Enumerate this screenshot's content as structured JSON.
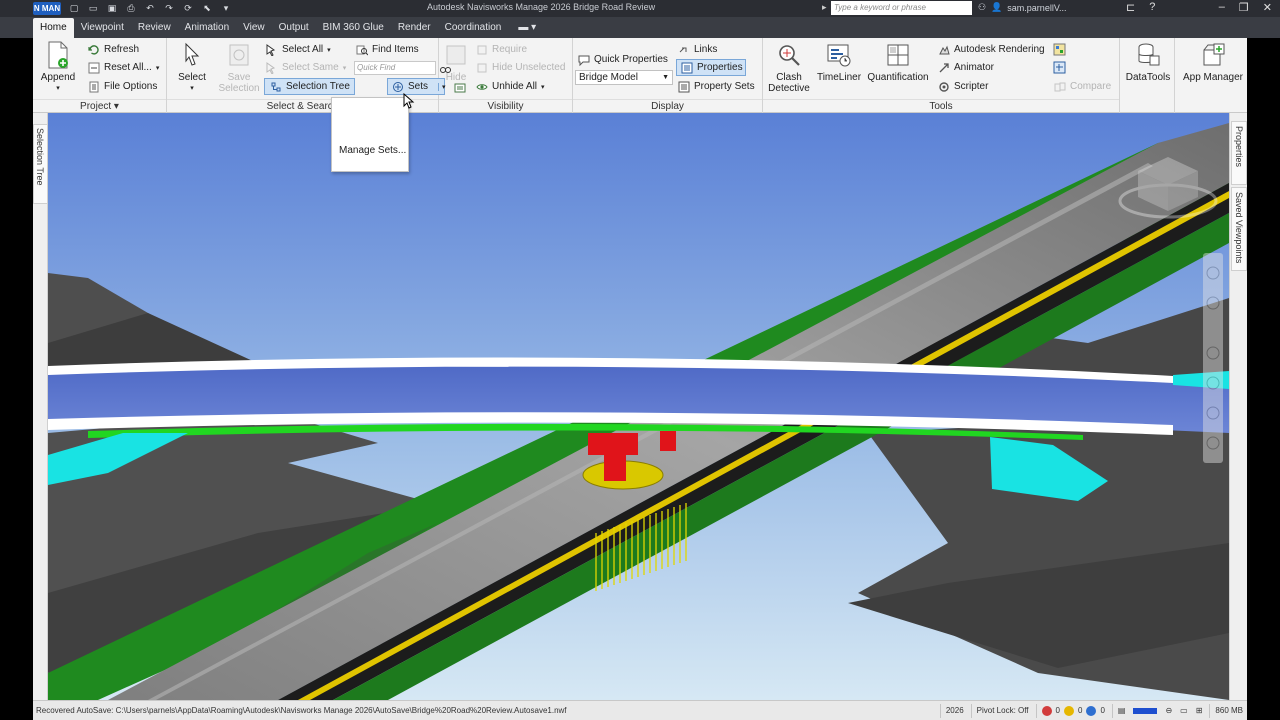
{
  "window": {
    "title": "Autodesk Navisworks Manage 2026    Bridge Road Review",
    "app_badge": "N MAN",
    "search_placeholder": "Type a keyword or phrase",
    "user": "sam.parnellV..."
  },
  "tabs": [
    "Home",
    "Viewpoint",
    "Review",
    "Animation",
    "View",
    "Output",
    "BIM 360 Glue",
    "Render",
    "Coordination"
  ],
  "tab_extra": "▬ ▾",
  "ribbon": {
    "project": {
      "label": "Project ▾",
      "append": "Append",
      "refresh": "Refresh",
      "reset_all": "Reset All...",
      "file_options": "File Options"
    },
    "select_search": {
      "label": "Select & Search",
      "select": "Select",
      "save_selection": "Save Selection",
      "select_all": "Select All",
      "select_same": "Select Same",
      "selection_tree": "Selection Tree",
      "find_items": "Find Items",
      "quick_find_placeholder": "Quick Find",
      "sets": "Sets"
    },
    "visibility": {
      "label": "Visibility",
      "hide": "Hide",
      "require": "Require",
      "hide_unselected": "Hide Unselected",
      "unhide_all": "Unhide All"
    },
    "display": {
      "label": "Display",
      "quick_properties": "Quick Properties",
      "model_dropdown": "Bridge Model",
      "links": "Links",
      "properties": "Properties",
      "property_sets": "Property Sets"
    },
    "tools": {
      "label": "Tools",
      "clash_detective": "Clash Detective",
      "timeliner": "TimeLiner",
      "quantification": "Quantification",
      "autodesk_rendering": "Autodesk Rendering",
      "animator": "Animator",
      "scripter": "Scripter",
      "compare": "Compare"
    },
    "datatools": "DataTools",
    "app_manager": "App Manager"
  },
  "sets_menu": {
    "manage_sets": "Manage Sets..."
  },
  "docks": {
    "left_tab": "Selection Tree",
    "right_tab_1": "Properties",
    "right_tab_2": "Saved Viewpoints"
  },
  "status": {
    "autosave": "Recovered AutoSave: C:\\Users\\parnels\\AppData\\Roaming\\Autodesk\\Navisworks Manage 2026\\AutoSave\\Bridge%20Road%20Review.Autosave1.nwf",
    "year": "2026",
    "pivot": "Pivot Lock: Off",
    "count_red": "0",
    "count_yellow": "0",
    "count_blue": "0",
    "memory": "860 MB"
  },
  "colors": {
    "sky_top": "#5f86d8",
    "sky_bottom": "#cfe2f2",
    "road_green": "#1d8a1d",
    "bridge_blue": "#5670c9",
    "highlight_green": "#21d621",
    "cyan": "#19e3e3",
    "red": "#e0141a",
    "yellow": "#e0d400"
  }
}
